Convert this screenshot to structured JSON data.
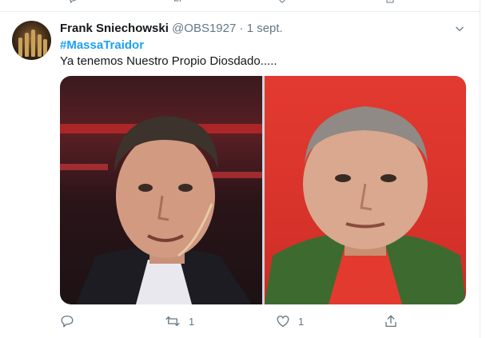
{
  "tweet": {
    "name": "Frank Sniechowski",
    "handle": "@OBS1927",
    "separator": "·",
    "date": "1 sept.",
    "hashtag": "#MassaTraidor",
    "text": "Ya tenemos Nuestro Propio Diosdado.....",
    "media": {
      "left_image": "man-with-headset-microphone",
      "right_image": "man-in-green-jacket-red-shirt"
    },
    "actions": {
      "reply_count": "",
      "retweet_count": "1",
      "like_count": "1"
    }
  },
  "colors": {
    "accent": "#1da1f2",
    "secondary_text": "#657786",
    "border": "#e6ecf0"
  },
  "icons": [
    "reply-icon",
    "retweet-icon",
    "like-icon",
    "share-icon",
    "caret-down-icon"
  ]
}
